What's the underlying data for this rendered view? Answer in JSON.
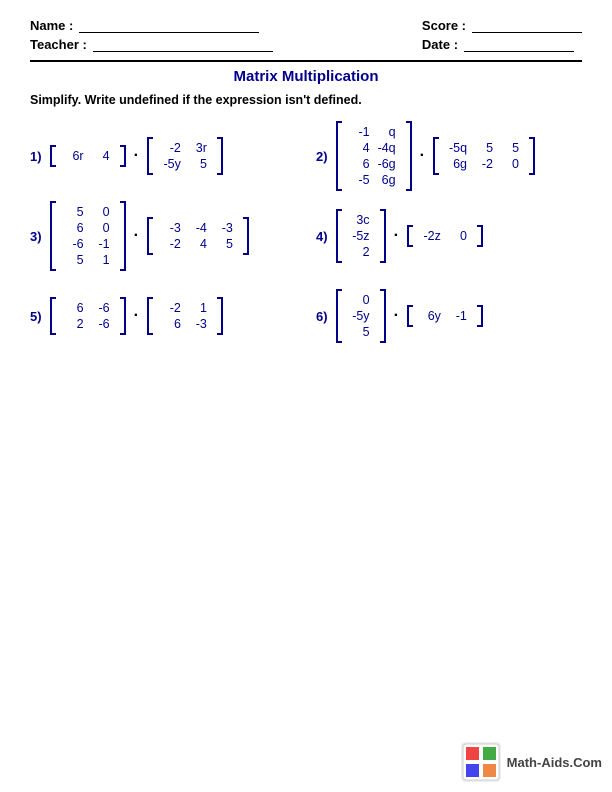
{
  "header": {
    "name_label": "Name :",
    "teacher_label": "Teacher :",
    "score_label": "Score :",
    "date_label": "Date :"
  },
  "title": "Matrix Multiplication",
  "instructions": "Simplify. Write undefined if the expression isn't defined.",
  "problems": [
    {
      "num": "1)",
      "left_matrix": [
        [
          "6r",
          "4"
        ]
      ],
      "right_matrix": [
        [
          "-2",
          "3r"
        ],
        [
          "-5y",
          "5"
        ]
      ]
    },
    {
      "num": "2)",
      "left_matrix": [
        [
          "-1",
          "q"
        ],
        [
          "4",
          "-4q"
        ],
        [
          "6",
          "-6g"
        ],
        [
          "-5",
          "6g"
        ]
      ],
      "right_matrix": [
        [
          "-5q",
          "5",
          "5"
        ],
        [
          "6g",
          "-2",
          "0"
        ]
      ]
    },
    {
      "num": "3)",
      "left_matrix": [
        [
          "5",
          "0"
        ],
        [
          "6",
          "0"
        ],
        [
          "-6",
          "-1"
        ],
        [
          "5",
          "1"
        ]
      ],
      "right_matrix": [
        [
          "-3",
          "-4",
          "-3"
        ],
        [
          "-2",
          "4",
          "5"
        ]
      ]
    },
    {
      "num": "4)",
      "left_matrix": [
        [
          "3c"
        ],
        [
          "-5z"
        ],
        [
          "2"
        ]
      ],
      "right_matrix": [
        [
          "-2z",
          "0"
        ]
      ]
    },
    {
      "num": "5)",
      "left_matrix": [
        [
          "6",
          "-6"
        ],
        [
          "2",
          "-6"
        ]
      ],
      "right_matrix": [
        [
          "-2",
          "1"
        ],
        [
          "6",
          "-3"
        ]
      ]
    },
    {
      "num": "6)",
      "left_matrix": [
        [
          "0"
        ],
        [
          "-5y"
        ],
        [
          "5"
        ]
      ],
      "right_matrix": [
        [
          "6y",
          "-1"
        ]
      ]
    }
  ],
  "watermark": {
    "text": "Math-Aids.Com"
  }
}
